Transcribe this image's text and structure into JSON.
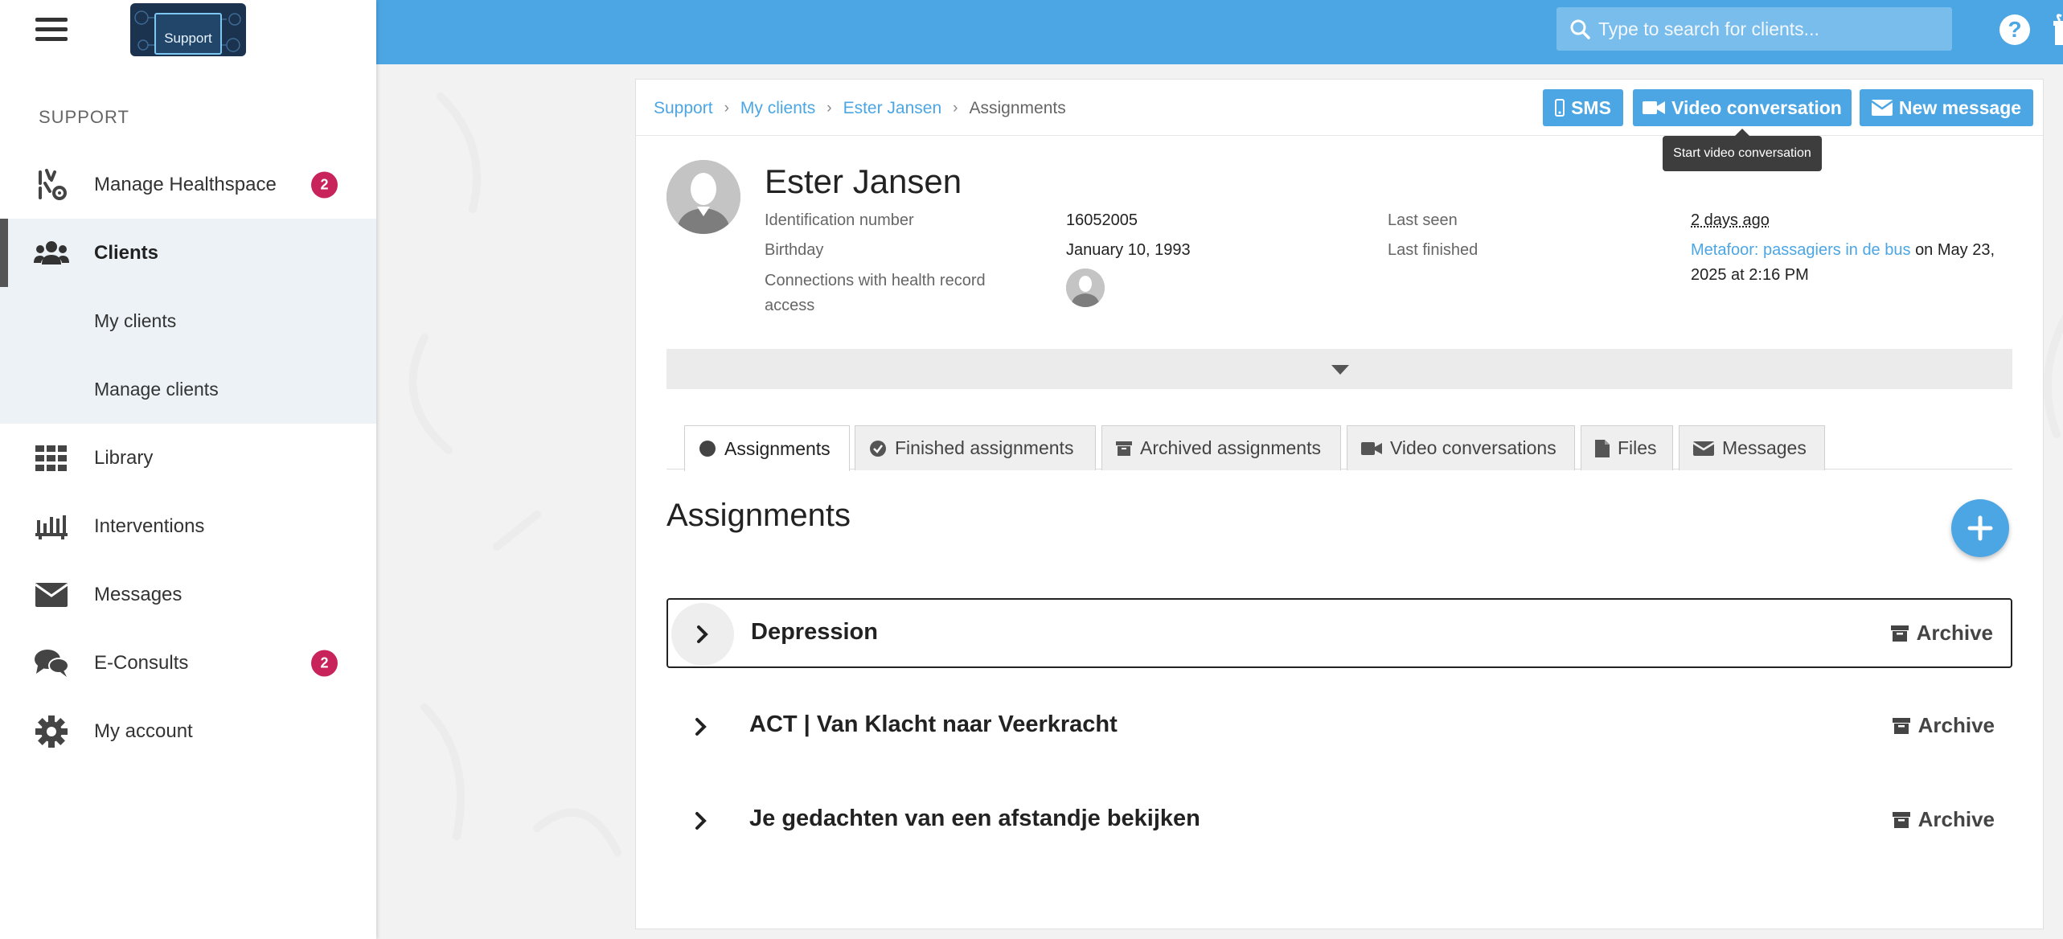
{
  "colors": {
    "primary": "#4ca6e4",
    "badge": "#c8235a",
    "active_bg": "#ecf2f6",
    "text": "#333333"
  },
  "sidebar": {
    "logo_text": "Support",
    "section_label": "SUPPORT",
    "items": [
      {
        "label": "Manage Healthspace",
        "icon": "healthspace-gear-icon",
        "badge": "2"
      },
      {
        "label": "Clients",
        "icon": "users-icon"
      },
      {
        "label": "My clients"
      },
      {
        "label": "Manage clients"
      },
      {
        "label": "Library",
        "icon": "grid-icon"
      },
      {
        "label": "Interventions",
        "icon": "interventions-icon"
      },
      {
        "label": "Messages",
        "icon": "envelope-icon"
      },
      {
        "label": "E-Consults",
        "icon": "chat-bubbles-icon",
        "badge": "2"
      },
      {
        "label": "My account",
        "icon": "gear-icon"
      }
    ]
  },
  "header": {
    "search_placeholder": "Type to search for clients...",
    "help_label": "?"
  },
  "breadcrumb": [
    "Support",
    "My clients",
    "Ester Jansen",
    "Assignments"
  ],
  "actions": {
    "sms": "SMS",
    "video": "Video conversation",
    "new_message": "New message",
    "tooltip": "Start video conversation"
  },
  "client": {
    "name": "Ester Jansen",
    "id_label": "Identification number",
    "id_value": "16052005",
    "birthday_label": "Birthday",
    "birthday_value": "January 10, 1993",
    "connections_label": "Connections with health record access",
    "last_seen_label": "Last seen",
    "last_seen_value": "2 days ago",
    "last_finished_label": "Last finished",
    "last_finished_link": "Metafoor: passagiers in de bus",
    "last_finished_suffix": "on May 23, 2025 at 2:16 PM"
  },
  "tabs": [
    {
      "label": "Assignments",
      "icon": "dot-icon",
      "active": true
    },
    {
      "label": "Finished assignments",
      "icon": "check-circle-icon"
    },
    {
      "label": "Archived assignments",
      "icon": "archive-icon"
    },
    {
      "label": "Video conversations",
      "icon": "video-icon"
    },
    {
      "label": "Files",
      "icon": "file-icon"
    },
    {
      "label": "Messages",
      "icon": "envelope-icon"
    }
  ],
  "assignments": {
    "title": "Assignments",
    "archive_label": "Archive",
    "items": [
      {
        "title": "Depression"
      },
      {
        "title": "ACT | Van Klacht naar Veerkracht"
      },
      {
        "title": "Je gedachten van een afstandje bekijken"
      }
    ]
  }
}
